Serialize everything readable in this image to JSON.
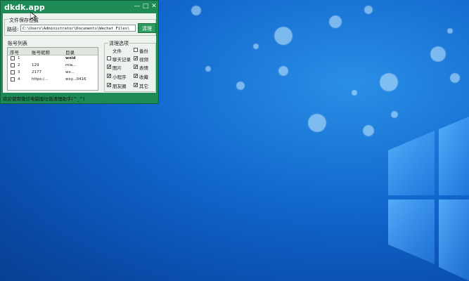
{
  "window": {
    "title": "dkdk.app",
    "minimize": "—",
    "maximize": "□",
    "close": "✕"
  },
  "save_location": {
    "group_label": "文件保存位置",
    "path_label": "路径:",
    "path_value": "C:\\Users\\Administrator\\Documents\\Wechat Files\\",
    "clean_button": "清理"
  },
  "account_list": {
    "group_label": "账号列表",
    "columns": [
      "序号",
      "账号昵称",
      "目录"
    ],
    "rows": [
      {
        "no": "1",
        "nickname": "",
        "dir": "wxid"
      },
      {
        "no": "2",
        "nickname": "129",
        "dir": "mia..."
      },
      {
        "no": "3",
        "nickname": "2177",
        "dir": "wx..."
      },
      {
        "no": "4",
        "nickname": "https:/...",
        "dir": "wxy...0416"
      }
    ]
  },
  "clean_options": {
    "group_label": "清理选项",
    "items": [
      {
        "label": "文件",
        "checked": false
      },
      {
        "label": "备份",
        "checked": false
      },
      {
        "label": "聊天记录",
        "checked": false
      },
      {
        "label": "视频",
        "checked": true
      },
      {
        "label": "图片",
        "checked": true
      },
      {
        "label": "表情",
        "checked": true
      },
      {
        "label": "小程序",
        "checked": true
      },
      {
        "label": "收藏",
        "checked": true
      },
      {
        "label": "朋友圈",
        "checked": true
      },
      {
        "label": "其它",
        "checked": true
      }
    ]
  },
  "status_bar": {
    "text": "欢迎使用微信电脑版垃圾清理助手(^_^)"
  },
  "colors": {
    "app_accent": "#1e8a55",
    "desktop_blue": "#1166cc"
  },
  "icons": {
    "cursor": "mouse-cursor-icon",
    "windows_logo": "windows-logo-icon"
  }
}
